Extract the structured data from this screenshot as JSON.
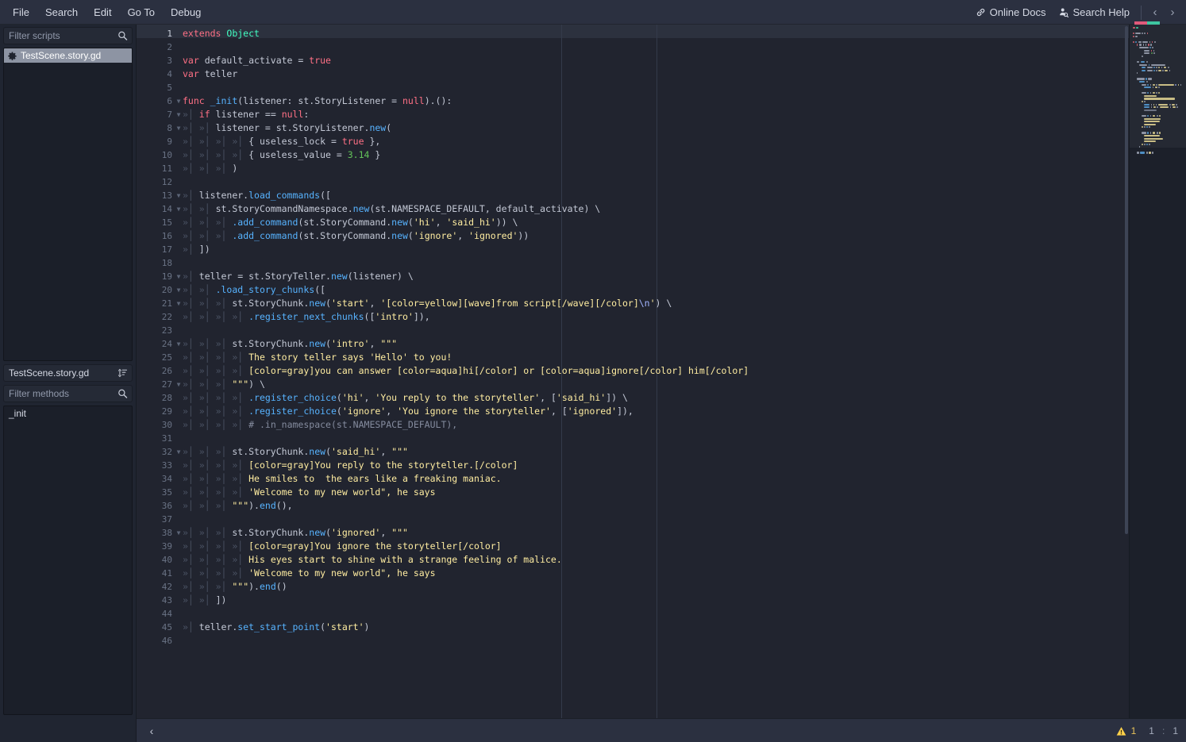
{
  "menubar": {
    "items": [
      "File",
      "Search",
      "Edit",
      "Go To",
      "Debug"
    ],
    "online_docs": "Online Docs",
    "search_help": "Search Help",
    "nav_back": "‹",
    "nav_forward": "›"
  },
  "sidebar": {
    "filter_scripts_placeholder": "Filter scripts",
    "scripts": [
      {
        "name": "TestScene.story.gd",
        "selected": true
      }
    ],
    "current_file": "TestScene.story.gd",
    "filter_methods_placeholder": "Filter methods",
    "methods": [
      "_init"
    ]
  },
  "editor": {
    "current_line": 1,
    "lines": [
      {
        "n": 1,
        "fold": "",
        "tabs": 0,
        "cur": true,
        "tokens": [
          {
            "t": "extends ",
            "c": "k"
          },
          {
            "t": "Object",
            "c": "ty"
          }
        ]
      },
      {
        "n": 2,
        "fold": "",
        "tabs": 0,
        "tokens": []
      },
      {
        "n": 3,
        "fold": "",
        "tabs": 0,
        "tokens": [
          {
            "t": "var",
            "c": "k"
          },
          {
            "t": " default_activate ",
            "c": "mb"
          },
          {
            "t": "=",
            "c": "mb"
          },
          {
            "t": " ",
            "c": "mb"
          },
          {
            "t": "true",
            "c": "k"
          }
        ]
      },
      {
        "n": 4,
        "fold": "",
        "tabs": 0,
        "tokens": [
          {
            "t": "var",
            "c": "k"
          },
          {
            "t": " teller",
            "c": "mb"
          }
        ]
      },
      {
        "n": 5,
        "fold": "",
        "tabs": 0,
        "tokens": []
      },
      {
        "n": 6,
        "fold": "v",
        "tabs": 0,
        "tokens": [
          {
            "t": "func ",
            "c": "k"
          },
          {
            "t": "_init",
            "c": "fn"
          },
          {
            "t": "(listener: ",
            "c": "mb"
          },
          {
            "t": "st.StoryListener",
            "c": "mb"
          },
          {
            "t": " = ",
            "c": "mb"
          },
          {
            "t": "null",
            "c": "k"
          },
          {
            "t": ").():",
            "c": "mb"
          }
        ]
      },
      {
        "n": 7,
        "fold": "v",
        "tabs": 1,
        "tokens": [
          {
            "t": "if",
            "c": "k"
          },
          {
            "t": " listener ",
            "c": "mb"
          },
          {
            "t": "==",
            "c": "mb"
          },
          {
            "t": " ",
            "c": "mb"
          },
          {
            "t": "null",
            "c": "k"
          },
          {
            "t": ":",
            "c": "mb"
          }
        ]
      },
      {
        "n": 8,
        "fold": "v",
        "tabs": 2,
        "tokens": [
          {
            "t": "listener = st.StoryListener.",
            "c": "mb"
          },
          {
            "t": "new",
            "c": "fn"
          },
          {
            "t": "(",
            "c": "mb"
          }
        ]
      },
      {
        "n": 9,
        "fold": "",
        "tabs": 4,
        "tokens": [
          {
            "t": "{ useless_lock = ",
            "c": "mb"
          },
          {
            "t": "true",
            "c": "k"
          },
          {
            "t": " },",
            "c": "mb"
          }
        ]
      },
      {
        "n": 10,
        "fold": "",
        "tabs": 4,
        "tokens": [
          {
            "t": "{ useless_value = ",
            "c": "mb"
          },
          {
            "t": "3.14",
            "c": "nu"
          },
          {
            "t": " }",
            "c": "mb"
          }
        ]
      },
      {
        "n": 11,
        "fold": "",
        "tabs": 3,
        "tokens": [
          {
            "t": ")",
            "c": "mb"
          }
        ]
      },
      {
        "n": 12,
        "fold": "",
        "tabs": 0,
        "tokens": []
      },
      {
        "n": 13,
        "fold": "v",
        "tabs": 1,
        "tokens": [
          {
            "t": "listener.",
            "c": "mb"
          },
          {
            "t": "load_commands",
            "c": "fn"
          },
          {
            "t": "([",
            "c": "mb"
          }
        ]
      },
      {
        "n": 14,
        "fold": "v",
        "tabs": 2,
        "tokens": [
          {
            "t": "st.StoryCommandNamespace.",
            "c": "mb"
          },
          {
            "t": "new",
            "c": "fn"
          },
          {
            "t": "(st.NAMESPACE_DEFAULT, default_activate) \\",
            "c": "mb"
          }
        ]
      },
      {
        "n": 15,
        "fold": "",
        "tabs": 3,
        "tokens": [
          {
            "t": ".add_command",
            "c": "fn"
          },
          {
            "t": "(st.StoryCommand.",
            "c": "mb"
          },
          {
            "t": "new",
            "c": "fn"
          },
          {
            "t": "(",
            "c": "mb"
          },
          {
            "t": "'hi'",
            "c": "st"
          },
          {
            "t": ", ",
            "c": "mb"
          },
          {
            "t": "'said_hi'",
            "c": "st"
          },
          {
            "t": ")) \\",
            "c": "mb"
          }
        ]
      },
      {
        "n": 16,
        "fold": "",
        "tabs": 3,
        "tokens": [
          {
            "t": ".add_command",
            "c": "fn"
          },
          {
            "t": "(st.StoryCommand.",
            "c": "mb"
          },
          {
            "t": "new",
            "c": "fn"
          },
          {
            "t": "(",
            "c": "mb"
          },
          {
            "t": "'ignore'",
            "c": "st"
          },
          {
            "t": ", ",
            "c": "mb"
          },
          {
            "t": "'ignored'",
            "c": "st"
          },
          {
            "t": "))",
            "c": "mb"
          }
        ]
      },
      {
        "n": 17,
        "fold": "",
        "tabs": 1,
        "tokens": [
          {
            "t": "])",
            "c": "mb"
          }
        ]
      },
      {
        "n": 18,
        "fold": "",
        "tabs": 0,
        "tokens": []
      },
      {
        "n": 19,
        "fold": "v",
        "tabs": 1,
        "tokens": [
          {
            "t": "teller = st.StoryTeller.",
            "c": "mb"
          },
          {
            "t": "new",
            "c": "fn"
          },
          {
            "t": "(listener) \\",
            "c": "mb"
          }
        ]
      },
      {
        "n": 20,
        "fold": "v",
        "tabs": 2,
        "tokens": [
          {
            "t": ".load_story_chunks",
            "c": "fn"
          },
          {
            "t": "([",
            "c": "mb"
          }
        ]
      },
      {
        "n": 21,
        "fold": "v",
        "tabs": 3,
        "tokens": [
          {
            "t": "st.StoryChunk.",
            "c": "mb"
          },
          {
            "t": "new",
            "c": "fn"
          },
          {
            "t": "(",
            "c": "mb"
          },
          {
            "t": "'start'",
            "c": "st"
          },
          {
            "t": ", ",
            "c": "mb"
          },
          {
            "t": "'[color=yellow][wave]from script[/wave][/color]",
            "c": "st"
          },
          {
            "t": "\\n",
            "c": "es"
          },
          {
            "t": "'",
            "c": "st"
          },
          {
            "t": ") \\",
            "c": "mb"
          }
        ]
      },
      {
        "n": 22,
        "fold": "",
        "tabs": 4,
        "tokens": [
          {
            "t": ".register_next_chunks",
            "c": "fn"
          },
          {
            "t": "([",
            "c": "mb"
          },
          {
            "t": "'intro'",
            "c": "st"
          },
          {
            "t": "]),",
            "c": "mb"
          }
        ]
      },
      {
        "n": 23,
        "fold": "",
        "tabs": 0,
        "tokens": []
      },
      {
        "n": 24,
        "fold": "v",
        "tabs": 3,
        "tokens": [
          {
            "t": "st.StoryChunk.",
            "c": "mb"
          },
          {
            "t": "new",
            "c": "fn"
          },
          {
            "t": "(",
            "c": "mb"
          },
          {
            "t": "'intro'",
            "c": "st"
          },
          {
            "t": ", ",
            "c": "mb"
          },
          {
            "t": "\"\"\"",
            "c": "st"
          }
        ]
      },
      {
        "n": 25,
        "fold": "",
        "tabs": 4,
        "tokens": [
          {
            "t": "The story teller says 'Hello' to you!",
            "c": "st"
          }
        ]
      },
      {
        "n": 26,
        "fold": "",
        "tabs": 4,
        "tokens": [
          {
            "t": "[color=gray]you can answer [color=aqua]hi[/color] or [color=aqua]ignore[/color] him[/color]",
            "c": "st"
          }
        ]
      },
      {
        "n": 27,
        "fold": "v",
        "tabs": 3,
        "tokens": [
          {
            "t": "\"\"\"",
            "c": "st"
          },
          {
            "t": ") \\",
            "c": "mb"
          }
        ]
      },
      {
        "n": 28,
        "fold": "",
        "tabs": 4,
        "tokens": [
          {
            "t": ".register_choice",
            "c": "fn"
          },
          {
            "t": "(",
            "c": "mb"
          },
          {
            "t": "'hi'",
            "c": "st"
          },
          {
            "t": ", ",
            "c": "mb"
          },
          {
            "t": "'You reply to the storyteller'",
            "c": "st"
          },
          {
            "t": ", [",
            "c": "mb"
          },
          {
            "t": "'said_hi'",
            "c": "st"
          },
          {
            "t": "]) \\",
            "c": "mb"
          }
        ]
      },
      {
        "n": 29,
        "fold": "",
        "tabs": 4,
        "tokens": [
          {
            "t": ".register_choice",
            "c": "fn"
          },
          {
            "t": "(",
            "c": "mb"
          },
          {
            "t": "'ignore'",
            "c": "st"
          },
          {
            "t": ", ",
            "c": "mb"
          },
          {
            "t": "'You ignore the storyteller'",
            "c": "st"
          },
          {
            "t": ", [",
            "c": "mb"
          },
          {
            "t": "'ignored'",
            "c": "st"
          },
          {
            "t": "]),",
            "c": "mb"
          }
        ]
      },
      {
        "n": 30,
        "fold": "",
        "tabs": 4,
        "tokens": [
          {
            "t": "# .in_namespace(st.NAMESPACE_DEFAULT),",
            "c": "cm"
          }
        ]
      },
      {
        "n": 31,
        "fold": "",
        "tabs": 0,
        "tokens": []
      },
      {
        "n": 32,
        "fold": "v",
        "tabs": 3,
        "tokens": [
          {
            "t": "st.StoryChunk.",
            "c": "mb"
          },
          {
            "t": "new",
            "c": "fn"
          },
          {
            "t": "(",
            "c": "mb"
          },
          {
            "t": "'said_hi'",
            "c": "st"
          },
          {
            "t": ", ",
            "c": "mb"
          },
          {
            "t": "\"\"\"",
            "c": "st"
          }
        ]
      },
      {
        "n": 33,
        "fold": "",
        "tabs": 4,
        "tokens": [
          {
            "t": "[color=gray]You reply to the storyteller.[/color]",
            "c": "st"
          }
        ]
      },
      {
        "n": 34,
        "fold": "",
        "tabs": 4,
        "tokens": [
          {
            "t": "He smiles to  the ears like a freaking maniac.",
            "c": "st"
          }
        ]
      },
      {
        "n": 35,
        "fold": "",
        "tabs": 4,
        "tokens": [
          {
            "t": "'Welcome to my new world\", he says",
            "c": "st"
          }
        ]
      },
      {
        "n": 36,
        "fold": "",
        "tabs": 3,
        "tokens": [
          {
            "t": "\"\"\"",
            "c": "st"
          },
          {
            "t": ").",
            "c": "mb"
          },
          {
            "t": "end",
            "c": "fn"
          },
          {
            "t": "(),",
            "c": "mb"
          }
        ]
      },
      {
        "n": 37,
        "fold": "",
        "tabs": 0,
        "tokens": []
      },
      {
        "n": 38,
        "fold": "v",
        "tabs": 3,
        "tokens": [
          {
            "t": "st.StoryChunk.",
            "c": "mb"
          },
          {
            "t": "new",
            "c": "fn"
          },
          {
            "t": "(",
            "c": "mb"
          },
          {
            "t": "'ignored'",
            "c": "st"
          },
          {
            "t": ", ",
            "c": "mb"
          },
          {
            "t": "\"\"\"",
            "c": "st"
          }
        ]
      },
      {
        "n": 39,
        "fold": "",
        "tabs": 4,
        "tokens": [
          {
            "t": "[color=gray]You ignore the storyteller[/color]",
            "c": "st"
          }
        ]
      },
      {
        "n": 40,
        "fold": "",
        "tabs": 4,
        "tokens": [
          {
            "t": "His eyes start to shine with a strange feeling of malice.",
            "c": "st"
          }
        ]
      },
      {
        "n": 41,
        "fold": "",
        "tabs": 4,
        "tokens": [
          {
            "t": "'Welcome to my new world\", he says",
            "c": "st"
          }
        ]
      },
      {
        "n": 42,
        "fold": "",
        "tabs": 3,
        "tokens": [
          {
            "t": "\"\"\"",
            "c": "st"
          },
          {
            "t": ").",
            "c": "mb"
          },
          {
            "t": "end",
            "c": "fn"
          },
          {
            "t": "()",
            "c": "mb"
          }
        ]
      },
      {
        "n": 43,
        "fold": "",
        "tabs": 2,
        "tokens": [
          {
            "t": "])",
            "c": "mb"
          }
        ]
      },
      {
        "n": 44,
        "fold": "",
        "tabs": 0,
        "tokens": []
      },
      {
        "n": 45,
        "fold": "",
        "tabs": 1,
        "tokens": [
          {
            "t": "teller.",
            "c": "mb"
          },
          {
            "t": "set_start_point",
            "c": "fn"
          },
          {
            "t": "(",
            "c": "mb"
          },
          {
            "t": "'start'",
            "c": "st"
          },
          {
            "t": ")",
            "c": "mb"
          }
        ]
      },
      {
        "n": 46,
        "fold": "",
        "tabs": 0,
        "tokens": []
      }
    ]
  },
  "statusbar": {
    "toggle_panel": "‹",
    "warning_count": "1",
    "line": "1",
    "separator": ":",
    "column": "1"
  },
  "colors": {
    "background": "#202531",
    "editor_bg": "#21242f",
    "panel": "#2b3040",
    "keyword": "#ff7085",
    "type": "#42ffc2",
    "function": "#57b3ff",
    "string": "#ffeda1",
    "number": "#63c259",
    "comment": "#848b9e",
    "warning": "#ffd24a",
    "selection": "#8d94a3"
  }
}
